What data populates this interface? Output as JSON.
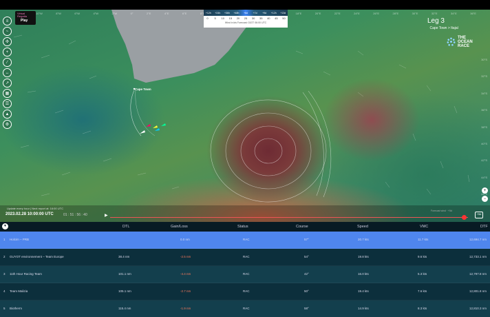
{
  "colors": {
    "highlight_row": "#4f86ee",
    "row_dark": "#0c2f3c",
    "row_alt": "#133f4d",
    "gain_negative": "#ff7a5c"
  },
  "player": {
    "logo_line1": "Virtual Regatta",
    "logo_button": "Play"
  },
  "toolbar": {
    "icons": [
      "layers-icon",
      "wind-icon",
      "compass-icon",
      "crosshair-icon",
      "ruler-icon",
      "measure-icon",
      "route-icon",
      "grid-icon",
      "list-icon",
      "chart-icon",
      "settings-icon"
    ]
  },
  "map": {
    "longitudes": [
      "10°W",
      "8°W",
      "6°W",
      "4°W",
      "2°W",
      "0°",
      "2°E",
      "4°E",
      "6°E",
      "8°E",
      "10°E",
      "12°E",
      "14°E",
      "16°E",
      "18°E",
      "20°E",
      "22°E",
      "24°E",
      "26°E",
      "28°E",
      "30°E",
      "32°E",
      "34°E",
      "36°E"
    ],
    "latitudes": [
      "30°S",
      "32°S",
      "34°S",
      "36°S",
      "38°S",
      "40°S",
      "42°S",
      "44°S",
      "46°S"
    ],
    "city": "Cape Town"
  },
  "wind_legend": {
    "top": [
      "+12h",
      "+24h",
      "+36h",
      "+48h",
      "+6d",
      "+7d",
      "+9d",
      "+12h",
      "+13d"
    ],
    "values": [
      "0",
      "5",
      "10",
      "15",
      "20",
      "25",
      "30",
      "35",
      "40",
      "45",
      "50"
    ],
    "footer": "Wind in kts    Forecast: 02/27 06:00 UTC"
  },
  "leg": {
    "title": "Leg 3",
    "route": "Cape Town > Itajaí"
  },
  "brand": {
    "line1": "THE",
    "line2": "OCEAN",
    "line3": "RACE"
  },
  "timeline": {
    "note": "Update every hour | Next report at: 16:00 UTC",
    "date": "2023.02.28 10:00:00 UTC",
    "clock": "01 : 51 : 56 : 40",
    "forecast_note": "Forecast wind  ·  +5d",
    "zoom_label": "+5d"
  },
  "table": {
    "headers": {
      "dtl": "DTL",
      "gain": "Gain/Loss",
      "status": "Status",
      "course": "Course",
      "speed": "Speed",
      "vmc": "VMC",
      "dtf": "DTF"
    },
    "rows": [
      {
        "rank": "1",
        "team": "Holcim – PRB",
        "dtl": "",
        "gain": "0.0 nm",
        "status": "RAC",
        "course": "57°",
        "speed": "20.7 kts",
        "vmc": "11.7 kts",
        "dtf": "12,694.7 nm"
      },
      {
        "rank": "2",
        "team": "GUYOT environnement – Team Europe",
        "dtl": "38.4 nm",
        "gain": "-2.5 nm",
        "status": "RAC",
        "course": "54°",
        "speed": "19.8 kts",
        "vmc": "9.6 kts",
        "dtf": "12,733.1 nm"
      },
      {
        "rank": "3",
        "team": "11th Hour Racing Team",
        "dtl": "101.1 nm",
        "gain": "-4.4 nm",
        "status": "RAC",
        "course": "42°",
        "speed": "16.0 kts",
        "vmc": "5.3 kts",
        "dtf": "12,797.8 nm"
      },
      {
        "rank": "4",
        "team": "Team Malizia",
        "dtl": "105.1 nm",
        "gain": "-2.7 nm",
        "status": "RAC",
        "course": "50°",
        "speed": "19.4 kts",
        "vmc": "7.6 kts",
        "dtf": "12,801.8 nm"
      },
      {
        "rank": "5",
        "team": "Biotherm",
        "dtl": "115.4 nm",
        "gain": "-1.9 nm",
        "status": "RAC",
        "course": "58°",
        "speed": "14.9 kts",
        "vmc": "8.3 kts",
        "dtf": "12,810.3 nm"
      }
    ]
  }
}
